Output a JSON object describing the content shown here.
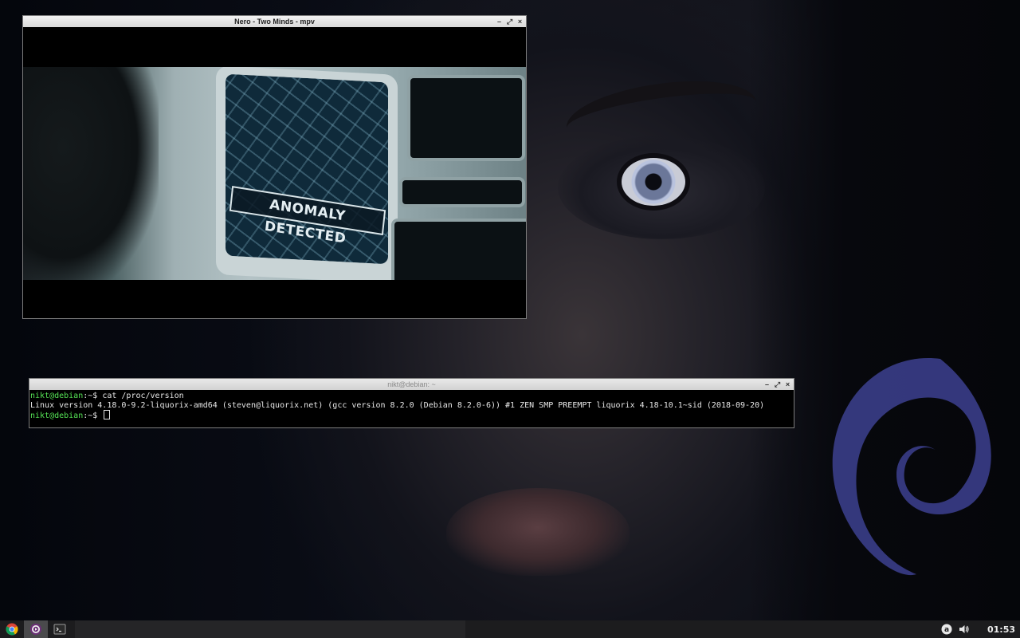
{
  "mpv_window": {
    "title": "Nero - Two Minds - mpv",
    "controls": [
      "–",
      "⤢",
      "×"
    ],
    "video_overlay_text": "ANOMALY DETECTED"
  },
  "terminal_window": {
    "title": "nikt@debian: ~",
    "controls": [
      "–",
      "⤢",
      "×"
    ],
    "lines": [
      {
        "user": "nikt@debian",
        "path": ":~$ ",
        "command": "cat /proc/version"
      },
      {
        "output": "Linux version 4.18.0-9.2-liquorix-amd64 (steven@liquorix.net) (gcc version 8.2.0 (Debian 8.2.0-6)) #1 ZEN SMP PREEMPT liquorix 4.18-10.1~sid (2018-09-20)"
      },
      {
        "user": "nikt@debian",
        "path": ":~$ ",
        "command": ""
      }
    ]
  },
  "taskbar": {
    "apps": [
      {
        "name": "chrome",
        "icon": "chrome-icon"
      },
      {
        "name": "mpv",
        "icon": "mpv-icon",
        "active": true
      },
      {
        "name": "terminal",
        "icon": "terminal-icon"
      }
    ],
    "tray": {
      "icons": [
        "keyboard-layout-icon",
        "volume-icon"
      ],
      "clock": "01:53"
    }
  },
  "colors": {
    "prompt_user": "#55e255",
    "debian_swirl": "#3b3f8c",
    "taskbar_bg": "#1c1c1e"
  }
}
